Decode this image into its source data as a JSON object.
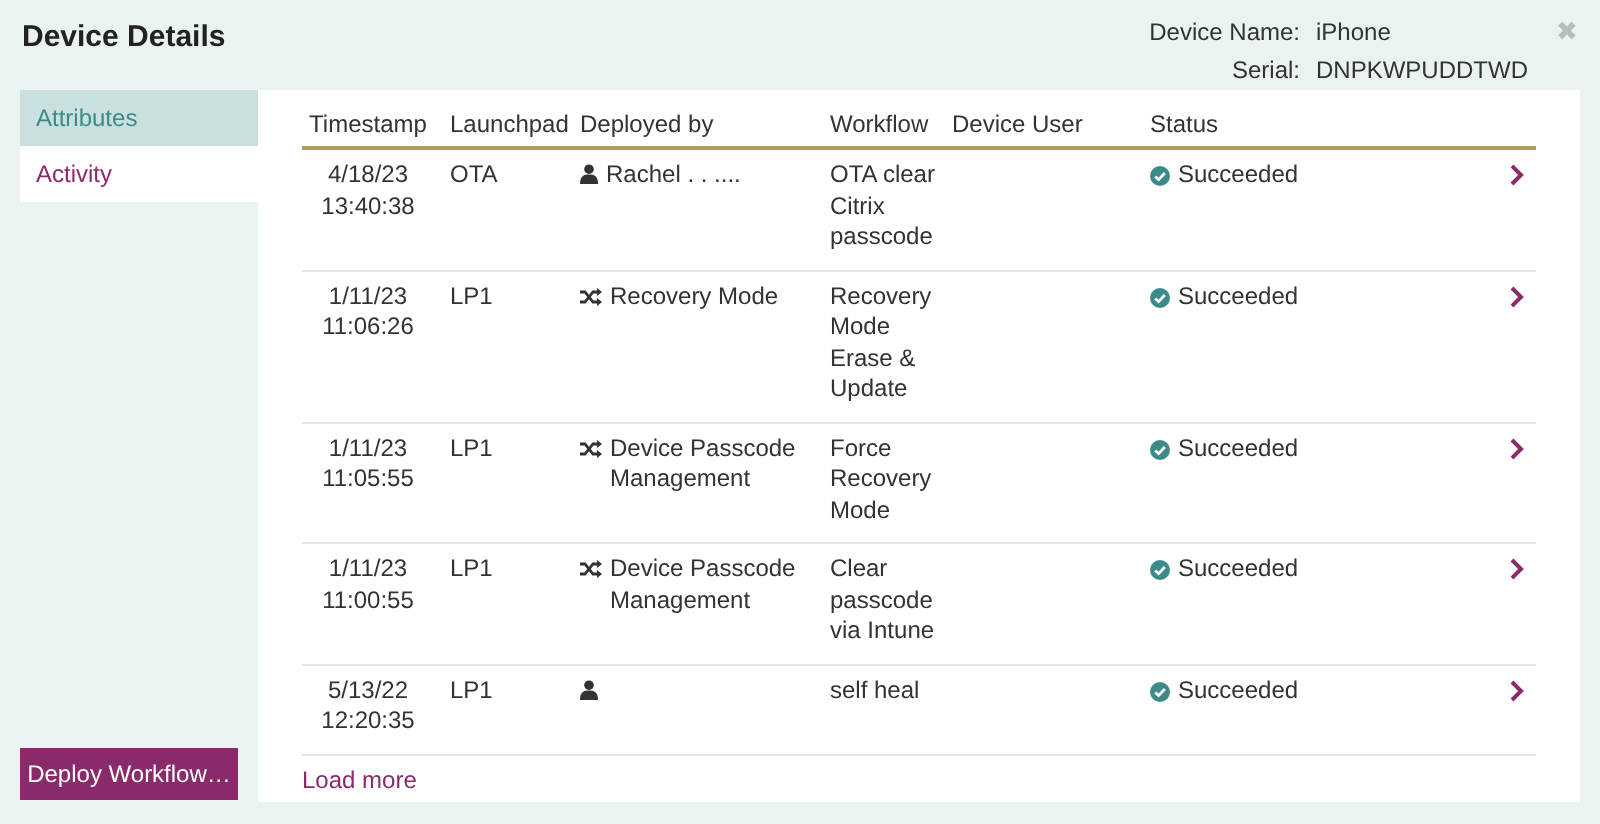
{
  "window": {
    "title": "Device Details",
    "close": "✖"
  },
  "device": [
    {
      "label": "Device Name:",
      "value": "iPhone"
    },
    {
      "label": "Serial:",
      "value": "DNPKWPUDDTWD"
    }
  ],
  "sidebar": {
    "items": [
      {
        "label": "Attributes",
        "selected": false
      },
      {
        "label": "Activity",
        "selected": true
      }
    ],
    "button": "Deploy Workflow…"
  },
  "table": {
    "columns": [
      "Timestamp",
      "Launchpad",
      "Deployed by",
      "Workflow",
      "Device User",
      "Status"
    ],
    "rows": [
      {
        "timestamp": [
          "4/18/23",
          "13:40:38"
        ],
        "launchpad": "OTA",
        "deployed_by": {
          "kind": "user",
          "text": "Rachel . . ...."
        },
        "workflow": [
          "OTA clear",
          "Citrix",
          "passcode"
        ],
        "status": "Succeeded"
      },
      {
        "timestamp": [
          "1/11/23",
          "11:06:26"
        ],
        "launchpad": "LP1",
        "deployed_by": {
          "kind": "workflow",
          "text": "Recovery Mode"
        },
        "workflow": [
          "Recovery",
          "Mode",
          "Erase &",
          "Update"
        ],
        "status": "Succeeded"
      },
      {
        "timestamp": [
          "1/11/23",
          "11:05:55"
        ],
        "launchpad": "LP1",
        "deployed_by": {
          "kind": "workflow",
          "text": "Device Passcode Management"
        },
        "workflow": [
          "Force",
          "Recovery",
          "Mode"
        ],
        "status": "Succeeded"
      },
      {
        "timestamp": [
          "1/11/23",
          "11:00:55"
        ],
        "launchpad": "LP1",
        "deployed_by": {
          "kind": "workflow",
          "text": "Device Passcode Management"
        },
        "workflow": [
          "Clear",
          "passcode",
          "via Intune"
        ],
        "status": "Succeeded"
      },
      {
        "timestamp": [
          "5/13/22",
          "12:20:35"
        ],
        "launchpad": "LP1",
        "deployed_by": {
          "kind": "user"
        },
        "workflow": [
          "self heal"
        ],
        "status": "Succeeded"
      }
    ],
    "load_more": "Load more"
  }
}
